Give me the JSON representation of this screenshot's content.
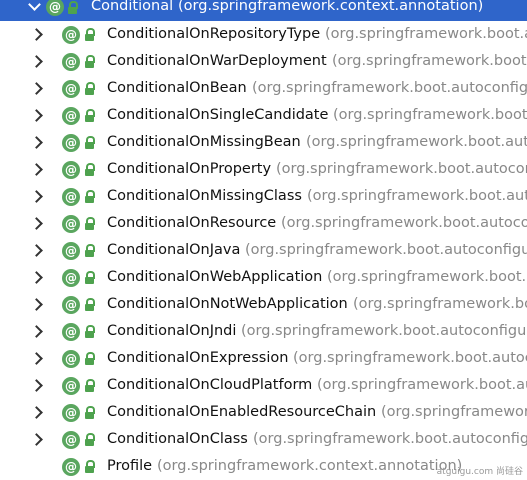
{
  "tree": {
    "root": {
      "name": "Conditional",
      "package": "(org.springframework.context.annotation)"
    },
    "items": [
      {
        "name": "ConditionalOnRepositoryType",
        "package": "(org.springframework.boot.autoconfigure.data)",
        "has_children": true
      },
      {
        "name": "ConditionalOnWarDeployment",
        "package": "(org.springframework.boot.autoconfigure.condition)",
        "has_children": true
      },
      {
        "name": "ConditionalOnBean",
        "package": "(org.springframework.boot.autoconfigure.condition)",
        "has_children": true
      },
      {
        "name": "ConditionalOnSingleCandidate",
        "package": "(org.springframework.boot.autoconfigure.condition)",
        "has_children": true
      },
      {
        "name": "ConditionalOnMissingBean",
        "package": "(org.springframework.boot.autoconfigure.condition)",
        "has_children": true
      },
      {
        "name": "ConditionalOnProperty",
        "package": "(org.springframework.boot.autoconfigure.condition)",
        "has_children": true
      },
      {
        "name": "ConditionalOnMissingClass",
        "package": "(org.springframework.boot.autoconfigure.condition)",
        "has_children": true
      },
      {
        "name": "ConditionalOnResource",
        "package": "(org.springframework.boot.autoconfigure.condition)",
        "has_children": true
      },
      {
        "name": "ConditionalOnJava",
        "package": "(org.springframework.boot.autoconfigure.condition)",
        "has_children": true
      },
      {
        "name": "ConditionalOnWebApplication",
        "package": "(org.springframework.boot.autoconfigure.condition)",
        "has_children": true
      },
      {
        "name": "ConditionalOnNotWebApplication",
        "package": "(org.springframework.boot.autoconfigure.condition)",
        "has_children": true
      },
      {
        "name": "ConditionalOnJndi",
        "package": "(org.springframework.boot.autoconfigure.condition)",
        "has_children": true
      },
      {
        "name": "ConditionalOnExpression",
        "package": "(org.springframework.boot.autoconfigure.condition)",
        "has_children": true
      },
      {
        "name": "ConditionalOnCloudPlatform",
        "package": "(org.springframework.boot.autoconfigure.condition)",
        "has_children": true
      },
      {
        "name": "ConditionalOnEnabledResourceChain",
        "package": "(org.springframework.boot.autoconfigure.web)",
        "has_children": true
      },
      {
        "name": "ConditionalOnClass",
        "package": "(org.springframework.boot.autoconfigure.condition)",
        "has_children": true
      },
      {
        "name": "Profile",
        "package": "(org.springframework.context.annotation)",
        "has_children": false
      }
    ]
  },
  "icons": {
    "annotation": "annotation-icon",
    "lock": "lock-icon",
    "expand": "chevron-right-icon"
  },
  "colors": {
    "selection": "#2f65ca",
    "annotation_green": "#5aa65f",
    "package_gray": "#888888"
  },
  "watermark": "atguigu.com 尚硅谷"
}
